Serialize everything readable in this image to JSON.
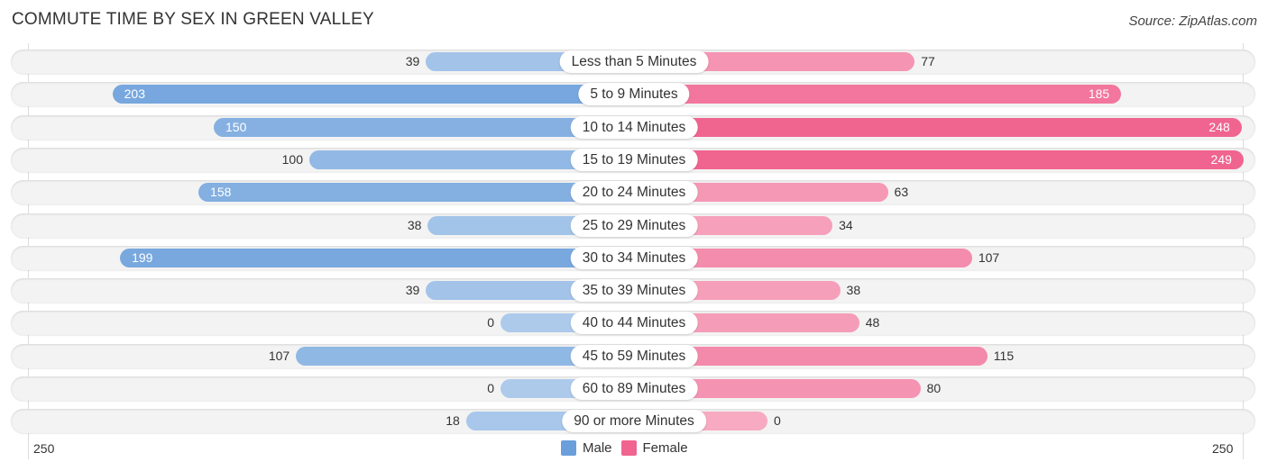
{
  "chart_data": {
    "type": "bar",
    "orientation": "horizontal-diverging",
    "title": "COMMUTE TIME BY SEX IN GREEN VALLEY",
    "source": "Source: ZipAtlas.com",
    "categories": [
      "Less than 5 Minutes",
      "5 to 9 Minutes",
      "10 to 14 Minutes",
      "15 to 19 Minutes",
      "20 to 24 Minutes",
      "25 to 29 Minutes",
      "30 to 34 Minutes",
      "35 to 39 Minutes",
      "40 to 44 Minutes",
      "45 to 59 Minutes",
      "60 to 89 Minutes",
      "90 or more Minutes"
    ],
    "series": [
      {
        "name": "Male",
        "color": "#6a9fdb",
        "values": [
          39,
          203,
          150,
          100,
          158,
          38,
          199,
          39,
          0,
          107,
          0,
          18
        ]
      },
      {
        "name": "Female",
        "color": "#f06490",
        "values": [
          77,
          185,
          248,
          249,
          63,
          34,
          107,
          38,
          48,
          115,
          80,
          0
        ]
      }
    ],
    "axis": {
      "left_tick": "250",
      "right_tick": "250",
      "max": 250
    },
    "legend": [
      {
        "label": "Male",
        "color": "#6a9fdb"
      },
      {
        "label": "Female",
        "color": "#f06490"
      }
    ],
    "legend_position": "bottom-center"
  }
}
